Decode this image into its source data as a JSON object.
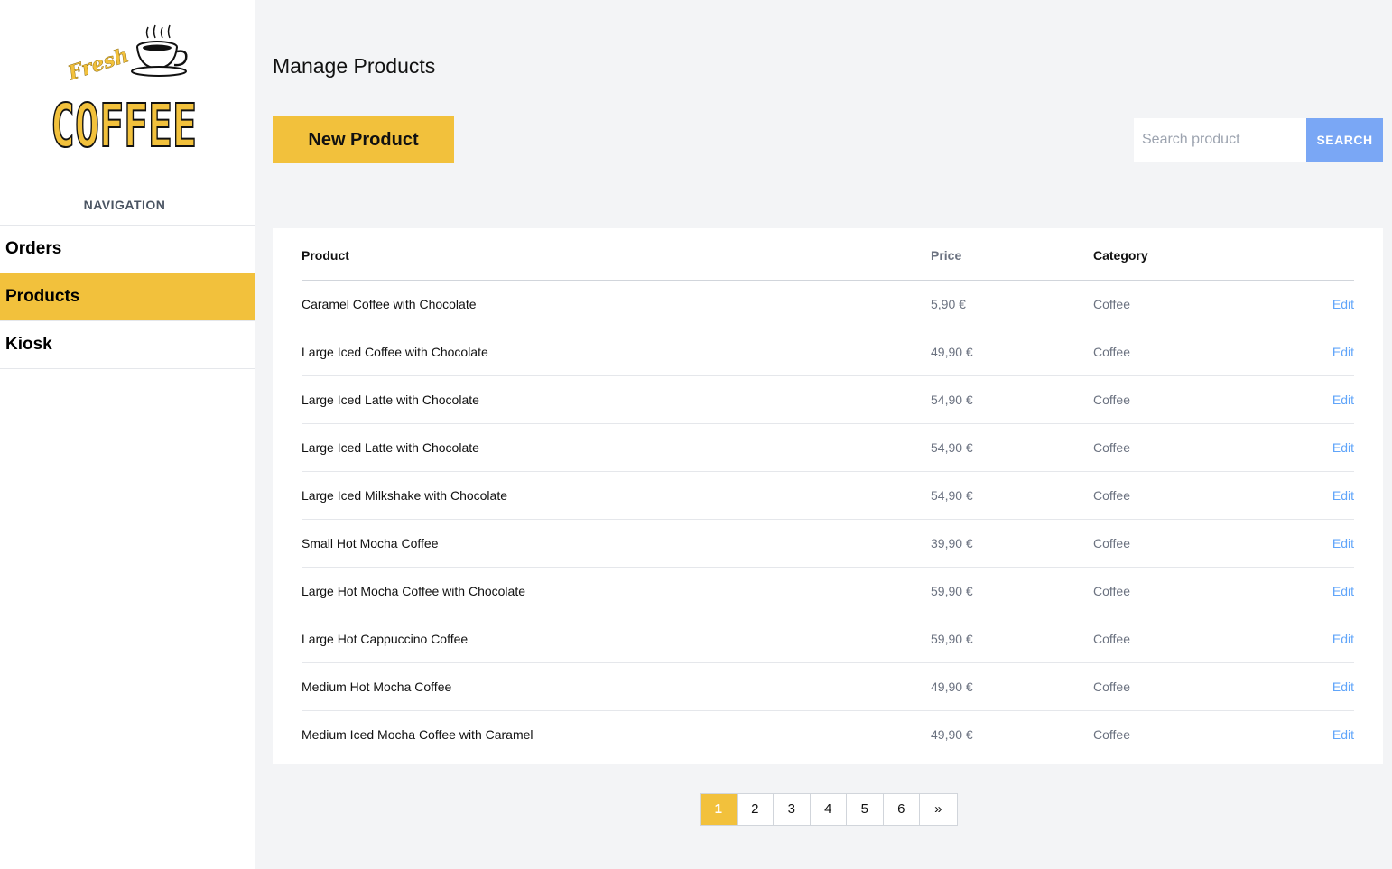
{
  "brand": {
    "logo_top": "Fresh",
    "logo_main": "COFFEE"
  },
  "navigation": {
    "heading": "NAVIGATION",
    "items": [
      {
        "label": "Orders",
        "active": false
      },
      {
        "label": "Products",
        "active": true
      },
      {
        "label": "Kiosk",
        "active": false
      }
    ]
  },
  "header": {
    "title": "Manage Products",
    "new_button": "New Product"
  },
  "search": {
    "placeholder": "Search product",
    "value": "",
    "button": "SEARCH"
  },
  "table": {
    "columns": [
      "Product",
      "Price",
      "Category",
      ""
    ],
    "rows": [
      {
        "product": "Caramel Coffee with Chocolate",
        "price": "5,90 €",
        "category": "Coffee",
        "action": "Edit"
      },
      {
        "product": "Large Iced Coffee with Chocolate",
        "price": "49,90 €",
        "category": "Coffee",
        "action": "Edit"
      },
      {
        "product": "Large Iced Latte with Chocolate",
        "price": "54,90 €",
        "category": "Coffee",
        "action": "Edit"
      },
      {
        "product": "Large Iced Latte with Chocolate",
        "price": "54,90 €",
        "category": "Coffee",
        "action": "Edit"
      },
      {
        "product": "Large Iced Milkshake with Chocolate",
        "price": "54,90 €",
        "category": "Coffee",
        "action": "Edit"
      },
      {
        "product": "Small Hot Mocha Coffee",
        "price": "39,90 €",
        "category": "Coffee",
        "action": "Edit"
      },
      {
        "product": "Large Hot Mocha Coffee with Chocolate",
        "price": "59,90 €",
        "category": "Coffee",
        "action": "Edit"
      },
      {
        "product": "Large Hot Cappuccino Coffee",
        "price": "59,90 €",
        "category": "Coffee",
        "action": "Edit"
      },
      {
        "product": "Medium Hot Mocha Coffee",
        "price": "49,90 €",
        "category": "Coffee",
        "action": "Edit"
      },
      {
        "product": "Medium Iced Mocha Coffee with Caramel",
        "price": "49,90 €",
        "category": "Coffee",
        "action": "Edit"
      }
    ]
  },
  "pagination": {
    "pages": [
      "1",
      "2",
      "3",
      "4",
      "5",
      "6",
      "»"
    ],
    "current": "1"
  },
  "colors": {
    "accent": "#f2c13c",
    "search_button": "#7aa7f5",
    "link": "#60a5fa",
    "background": "#f3f4f6"
  }
}
